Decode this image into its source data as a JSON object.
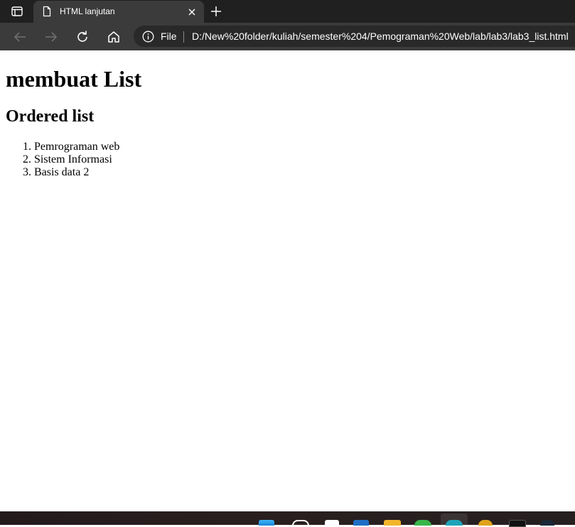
{
  "browser": {
    "tab": {
      "title": "HTML lanjutan"
    },
    "address_bar": {
      "scheme_label": "File",
      "url": "D:/New%20folder/kuliah/semester%204/Pemograman%20Web/lab/lab3/lab3_list.html"
    },
    "icons": {
      "tab_actions": "tab-actions-icon",
      "page": "page-icon",
      "close": "close-icon",
      "new_tab": "plus-icon",
      "back": "back-arrow-icon",
      "forward": "forward-arrow-icon",
      "refresh": "refresh-icon",
      "home": "home-icon",
      "info": "info-icon"
    },
    "colors": {
      "tabbar_bg": "#202020",
      "toolbar_bg": "#3b3b3b",
      "address_bg": "#292929"
    }
  },
  "page": {
    "heading1": "membuat List",
    "heading2": "Ordered list",
    "ordered_list": [
      "Pemrograman web",
      "Sistem Informasi",
      "Basis data 2"
    ]
  },
  "taskbar": {
    "icons": [
      "start-icon",
      "search-icon",
      "task-view-icon",
      "store-icon",
      "file-explorer-icon",
      "whatsapp-icon",
      "edge-icon",
      "app-icon",
      "epic-games-icon",
      "steam-icon"
    ]
  }
}
